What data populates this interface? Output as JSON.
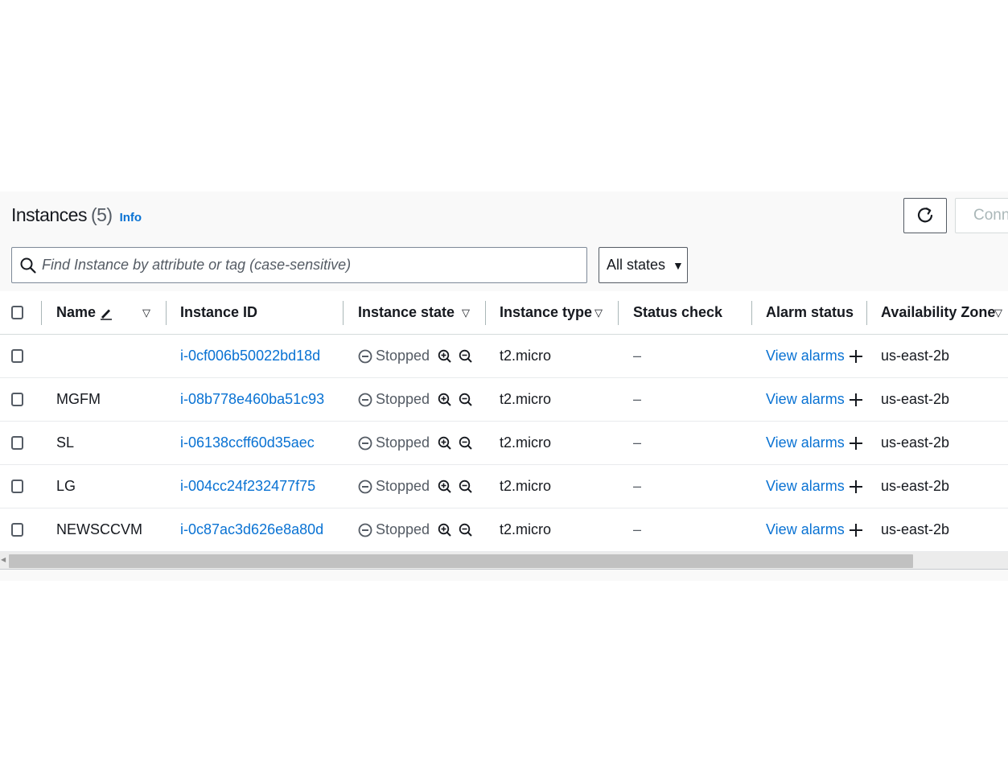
{
  "header": {
    "title": "Instances",
    "count": "(5)",
    "info_label": "Info"
  },
  "toolbar": {
    "refresh_icon": "refresh-icon",
    "connect_label": "Connect"
  },
  "search": {
    "value": "",
    "placeholder": "Find Instance by attribute or tag (case-sensitive)"
  },
  "state_filter": {
    "selected": "All states",
    "caret": "▼"
  },
  "table": {
    "columns": {
      "name": "Name",
      "instance_id": "Instance ID",
      "instance_state": "Instance state",
      "instance_type": "Instance type",
      "status_check": "Status check",
      "alarm_status": "Alarm status",
      "availability_zone": "Availability Zone"
    },
    "filter_glyph": "▽",
    "rows": [
      {
        "name": "",
        "instance_id": "i-0cf006b50022bd18d",
        "state": "Stopped",
        "type": "t2.micro",
        "status_check": "–",
        "alarm": "View alarms",
        "zone": "us-east-2b"
      },
      {
        "name": "MGFM",
        "instance_id": "i-08b778e460ba51c93",
        "state": "Stopped",
        "type": "t2.micro",
        "status_check": "–",
        "alarm": "View alarms",
        "zone": "us-east-2b"
      },
      {
        "name": "SL",
        "instance_id": "i-06138ccff60d35aec",
        "state": "Stopped",
        "type": "t2.micro",
        "status_check": "–",
        "alarm": "View alarms",
        "zone": "us-east-2b"
      },
      {
        "name": "LG",
        "instance_id": "i-004cc24f232477f75",
        "state": "Stopped",
        "type": "t2.micro",
        "status_check": "–",
        "alarm": "View alarms",
        "zone": "us-east-2b"
      },
      {
        "name": "NEWSCCVM",
        "instance_id": "i-0c87ac3d626e8a80d",
        "state": "Stopped",
        "type": "t2.micro",
        "status_check": "–",
        "alarm": "View alarms",
        "zone": "us-east-2b"
      }
    ]
  },
  "colors": {
    "link": "#0972d3",
    "text": "#16191f",
    "muted": "#545b64",
    "panel_bg": "#f9f9f9"
  }
}
